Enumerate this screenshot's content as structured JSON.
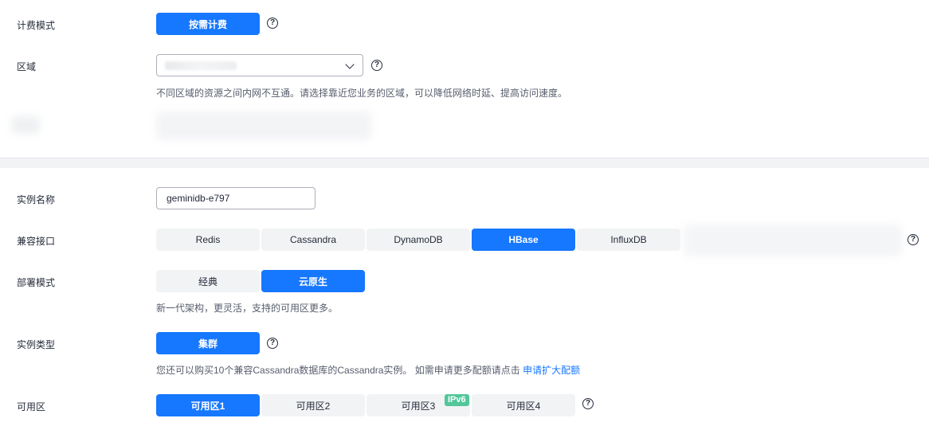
{
  "billing": {
    "label": "计费模式",
    "button": "按需计费"
  },
  "region": {
    "label": "区域",
    "hint": "不同区域的资源之间内网不互通。请选择靠近您业务的区域，可以降低网络时延、提高访问速度。"
  },
  "instance_name": {
    "label": "实例名称",
    "value": "geminidb-e797"
  },
  "compat": {
    "label": "兼容接口",
    "options": [
      "Redis",
      "Cassandra",
      "DynamoDB",
      "HBase",
      "InfluxDB"
    ],
    "selected": "HBase"
  },
  "deploy": {
    "label": "部署模式",
    "options": [
      "经典",
      "云原生"
    ],
    "selected": "云原生",
    "hint": "新一代架构，更灵活，支持的可用区更多。"
  },
  "instance_type": {
    "label": "实例类型",
    "button": "集群",
    "hint": "您还可以购买10个兼容Cassandra数据库的Cassandra实例。 如需申请更多配额请点击",
    "link": "申请扩大配额"
  },
  "az": {
    "label": "可用区",
    "options": [
      "可用区1",
      "可用区2",
      "可用区3",
      "可用区4"
    ],
    "selected": "可用区1",
    "tag": "IPv6"
  },
  "help_glyph": "?",
  "colors": {
    "primary": "#1677ff",
    "tag": "#52c79a",
    "segment_bg": "#f2f3f5"
  }
}
